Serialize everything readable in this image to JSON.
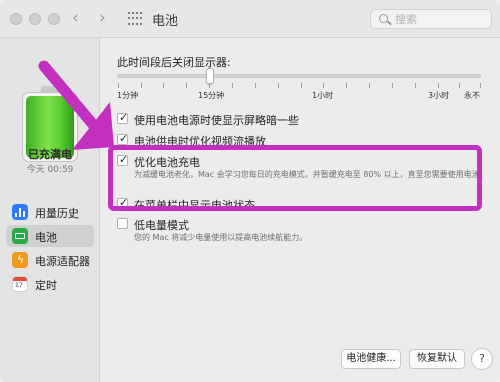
{
  "window": {
    "title": "电池"
  },
  "search": {
    "placeholder": "搜索"
  },
  "sidebar": {
    "status": "已充满电",
    "time": "今天 00:59",
    "items": [
      {
        "label": "用量历史",
        "icon": "usage-history-icon"
      },
      {
        "label": "电池",
        "icon": "battery-icon"
      },
      {
        "label": "电源适配器",
        "icon": "power-adapter-icon"
      },
      {
        "label": "定时",
        "icon": "schedule-icon"
      }
    ],
    "calendar_num": "17"
  },
  "slider": {
    "title": "此时间段后关闭显示器:",
    "ticks": [
      "1分钟",
      "15分钟",
      "1小时",
      "3小时",
      "永不"
    ]
  },
  "options": [
    {
      "label": "使用电池电源时使显示屏略暗一些",
      "checked": true
    },
    {
      "label": "电池供电时优化视频流播放",
      "checked": true
    },
    {
      "label": "优化电池充电",
      "checked": true,
      "desc": "为减缓电池老化，Mac 会学习您每日的充电模式，并暂缓充电至 80% 以上，直至您需要使用电池。"
    },
    {
      "label": "在菜单栏中显示电池状态",
      "checked": true
    },
    {
      "label": "低电量模式",
      "checked": false,
      "desc": "您的 Mac 将减少电量使用以提高电池续航能力。"
    }
  ],
  "buttons": {
    "battery_health": "电池健康...",
    "restore_defaults": "恢复默认",
    "help": "?"
  },
  "colors": {
    "highlight": "#c32fbf",
    "arrow": "#c32fbf",
    "accent": "#2f7bf6"
  }
}
